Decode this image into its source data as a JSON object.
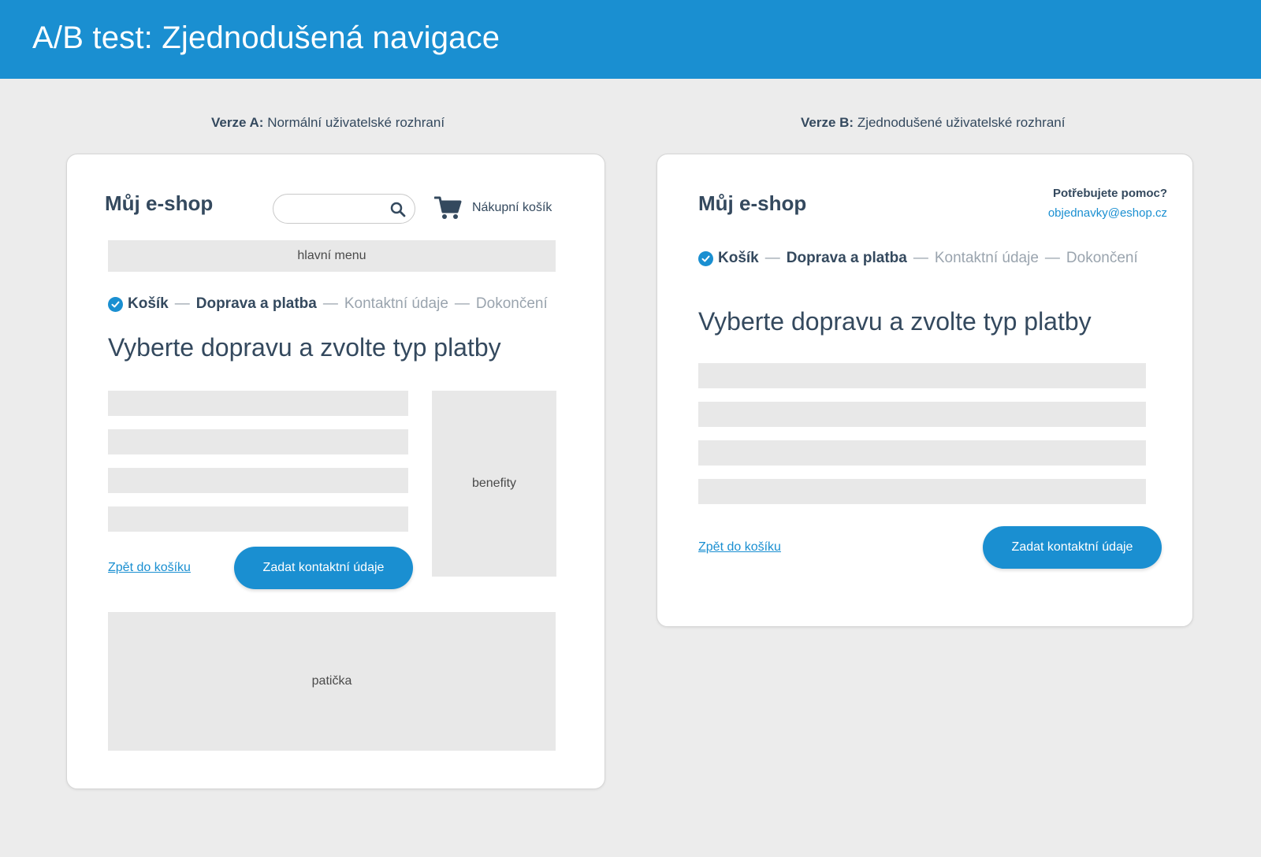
{
  "header": {
    "title": "A/B test: Zjednodušená navigace"
  },
  "version_a": {
    "label_bold": "Verze A:",
    "label_rest": " Normální uživatelské rozhraní",
    "logo": "Můj e-shop",
    "search": {
      "value": "",
      "placeholder": ""
    },
    "cart_label": "Nákupní košík",
    "main_menu": "hlavní menu",
    "steps": [
      {
        "label": "Košík",
        "state": "done"
      },
      {
        "label": "Doprava a platba",
        "state": "active"
      },
      {
        "label": "Kontaktní údaje",
        "state": "inactive"
      },
      {
        "label": "Dokončení",
        "state": "inactive"
      }
    ],
    "step_separator": "—",
    "heading": "Vyberte dopravu a zvolte typ platby",
    "benefits": "benefity",
    "back_link": "Zpět do košíku",
    "primary_button": "Zadat kontaktní údaje",
    "footer": "patička"
  },
  "version_b": {
    "label_bold": "Verze B:",
    "label_rest": " Zjednodušené uživatelské rozhraní",
    "logo": "Můj e-shop",
    "help_label": "Potřebujete pomoc?",
    "help_email": "objednavky@eshop.cz",
    "steps": [
      {
        "label": "Košík",
        "state": "done"
      },
      {
        "label": "Doprava a platba",
        "state": "active"
      },
      {
        "label": "Kontaktní údaje",
        "state": "inactive"
      },
      {
        "label": "Dokončení",
        "state": "inactive"
      }
    ],
    "step_separator": "—",
    "heading": "Vyberte dopravu a zvolte typ platby",
    "back_link": "Zpět do košíku",
    "primary_button": "Zadat kontaktní údaje"
  },
  "colors": {
    "brand_blue": "#1a8fd1",
    "text_dark": "#34495e",
    "text_muted": "#9aa4ae",
    "placeholder_gray": "#e8e8e8",
    "page_background": "#ececec"
  },
  "icons": {
    "search": "search-icon",
    "cart": "cart-icon",
    "check": "check-icon"
  }
}
